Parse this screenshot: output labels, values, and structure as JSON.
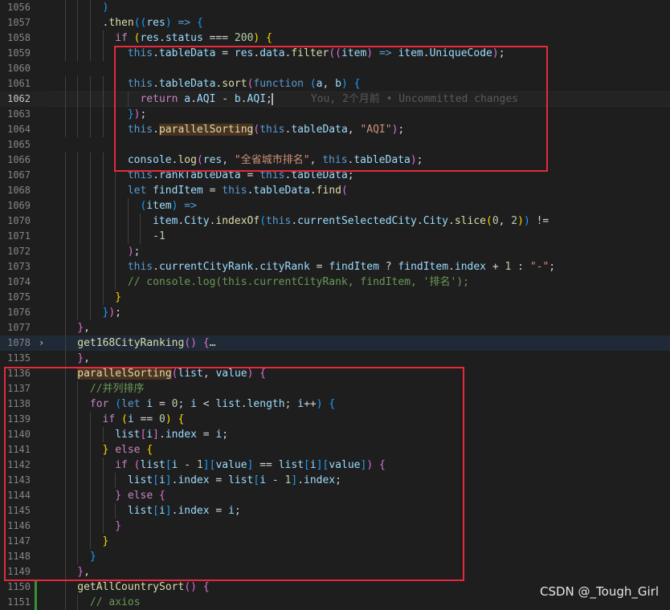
{
  "lines": [
    {
      "n": "1056",
      "ind": 8,
      "t": [
        [
          "p3",
          ")"
        ]
      ]
    },
    {
      "n": "1057",
      "ind": 8,
      "t": [
        [
          "pn",
          "."
        ],
        [
          "fn",
          "then"
        ],
        [
          "p3",
          "(("
        ],
        [
          "vr",
          "res"
        ],
        [
          "p3",
          ")"
        ],
        [
          "kw",
          " =>"
        ],
        [
          "pn",
          " "
        ],
        [
          "p3",
          "{"
        ]
      ]
    },
    {
      "n": "1058",
      "ind": 10,
      "t": [
        [
          "ctl",
          "if"
        ],
        [
          "pn",
          " "
        ],
        [
          "p1",
          "("
        ],
        [
          "vr",
          "res"
        ],
        [
          "pn",
          "."
        ],
        [
          "vr",
          "status"
        ],
        [
          "pn",
          " === "
        ],
        [
          "nm",
          "200"
        ],
        [
          "p1",
          ")"
        ],
        [
          "pn",
          " "
        ],
        [
          "p1",
          "{"
        ]
      ]
    },
    {
      "n": "1059",
      "ind": 12,
      "t": [
        [
          "kw",
          "this"
        ],
        [
          "pn",
          "."
        ],
        [
          "vr",
          "tableData"
        ],
        [
          "pn",
          " = "
        ],
        [
          "vr",
          "res"
        ],
        [
          "pn",
          "."
        ],
        [
          "vr",
          "data"
        ],
        [
          "pn",
          "."
        ],
        [
          "fn",
          "filter"
        ],
        [
          "p2",
          "(("
        ],
        [
          "vr",
          "item"
        ],
        [
          "p2",
          ")"
        ],
        [
          "kw",
          " =>"
        ],
        [
          "pn",
          " "
        ],
        [
          "vr",
          "item"
        ],
        [
          "pn",
          "."
        ],
        [
          "vr",
          "UniqueCode"
        ],
        [
          "p2",
          ")"
        ],
        [
          "pn",
          ";"
        ]
      ]
    },
    {
      "n": "1060",
      "ind": 0,
      "t": []
    },
    {
      "n": "1061",
      "ind": 12,
      "t": [
        [
          "kw",
          "this"
        ],
        [
          "pn",
          "."
        ],
        [
          "vr",
          "tableData"
        ],
        [
          "pn",
          "."
        ],
        [
          "fn",
          "sort"
        ],
        [
          "p2",
          "("
        ],
        [
          "kw",
          "function"
        ],
        [
          "pn",
          " "
        ],
        [
          "p3",
          "("
        ],
        [
          "vr",
          "a"
        ],
        [
          "pn",
          ", "
        ],
        [
          "vr",
          "b"
        ],
        [
          "p3",
          ")"
        ],
        [
          "pn",
          " "
        ],
        [
          "p3",
          "{"
        ]
      ]
    },
    {
      "n": "1062",
      "ind": 14,
      "cur": true,
      "t": [
        [
          "ctl",
          "return"
        ],
        [
          "pn",
          " "
        ],
        [
          "vr",
          "a"
        ],
        [
          "pn",
          "."
        ],
        [
          "vr",
          "AQI"
        ],
        [
          "pn",
          " - "
        ],
        [
          "vr",
          "b"
        ],
        [
          "pn",
          "."
        ],
        [
          "vr",
          "AQI"
        ],
        [
          "pn",
          ";"
        ]
      ]
    },
    {
      "n": "1063",
      "ind": 12,
      "t": [
        [
          "p3",
          "}"
        ],
        [
          "p2",
          ")"
        ],
        [
          "pn",
          ";"
        ]
      ]
    },
    {
      "n": "1064",
      "ind": 12,
      "t": [
        [
          "kw",
          "this"
        ],
        [
          "pn",
          "."
        ],
        [
          "fn",
          "parallelSorting",
          "hl"
        ],
        [
          "p2",
          "("
        ],
        [
          "kw",
          "this"
        ],
        [
          "pn",
          "."
        ],
        [
          "vr",
          "tableData"
        ],
        [
          "pn",
          ", "
        ],
        [
          "st",
          "\"AQI\""
        ],
        [
          "p2",
          ")"
        ],
        [
          "pn",
          ";"
        ]
      ]
    },
    {
      "n": "1065",
      "ind": 0,
      "t": []
    },
    {
      "n": "1066",
      "ind": 12,
      "t": [
        [
          "vr",
          "console"
        ],
        [
          "pn",
          "."
        ],
        [
          "fn",
          "log"
        ],
        [
          "p2",
          "("
        ],
        [
          "vr",
          "res"
        ],
        [
          "pn",
          ", "
        ],
        [
          "st",
          "\"全省城市排名\""
        ],
        [
          "pn",
          ", "
        ],
        [
          "kw",
          "this"
        ],
        [
          "pn",
          "."
        ],
        [
          "vr",
          "tableData"
        ],
        [
          "p2",
          ")"
        ],
        [
          "pn",
          ";"
        ]
      ]
    },
    {
      "n": "1067",
      "ind": 12,
      "t": [
        [
          "kw",
          "this"
        ],
        [
          "pn",
          "."
        ],
        [
          "vr",
          "rankTableData"
        ],
        [
          "pn",
          " = "
        ],
        [
          "kw",
          "this"
        ],
        [
          "pn",
          "."
        ],
        [
          "vr",
          "tableData"
        ],
        [
          "pn",
          ";"
        ]
      ]
    },
    {
      "n": "1068",
      "ind": 12,
      "t": [
        [
          "kw",
          "let"
        ],
        [
          "pn",
          " "
        ],
        [
          "vr",
          "findItem"
        ],
        [
          "pn",
          " = "
        ],
        [
          "kw",
          "this"
        ],
        [
          "pn",
          "."
        ],
        [
          "vr",
          "tableData"
        ],
        [
          "pn",
          "."
        ],
        [
          "fn",
          "find"
        ],
        [
          "p2",
          "("
        ]
      ]
    },
    {
      "n": "1069",
      "ind": 14,
      "t": [
        [
          "p3",
          "("
        ],
        [
          "vr",
          "item"
        ],
        [
          "p3",
          ")"
        ],
        [
          "kw",
          " =>"
        ]
      ]
    },
    {
      "n": "1070",
      "ind": 16,
      "t": [
        [
          "vr",
          "item"
        ],
        [
          "pn",
          "."
        ],
        [
          "vr",
          "City"
        ],
        [
          "pn",
          "."
        ],
        [
          "fn",
          "indexOf"
        ],
        [
          "p3",
          "("
        ],
        [
          "kw",
          "this"
        ],
        [
          "pn",
          "."
        ],
        [
          "vr",
          "currentSelectedCity"
        ],
        [
          "pn",
          "."
        ],
        [
          "vr",
          "City"
        ],
        [
          "pn",
          "."
        ],
        [
          "fn",
          "slice"
        ],
        [
          "p1",
          "("
        ],
        [
          "nm",
          "0"
        ],
        [
          "pn",
          ", "
        ],
        [
          "nm",
          "2"
        ],
        [
          "p1",
          ")"
        ],
        [
          "p3",
          ")"
        ],
        [
          "pn",
          " !="
        ]
      ]
    },
    {
      "n": "1071",
      "ind": 16,
      "t": [
        [
          "pn",
          "-"
        ],
        [
          "nm",
          "1"
        ]
      ]
    },
    {
      "n": "1072",
      "ind": 12,
      "t": [
        [
          "p2",
          ")"
        ],
        [
          "pn",
          ";"
        ]
      ]
    },
    {
      "n": "1073",
      "ind": 12,
      "t": [
        [
          "kw",
          "this"
        ],
        [
          "pn",
          "."
        ],
        [
          "vr",
          "currentCityRank"
        ],
        [
          "pn",
          "."
        ],
        [
          "vr",
          "cityRank"
        ],
        [
          "pn",
          " = "
        ],
        [
          "vr",
          "findItem"
        ],
        [
          "pn",
          " ? "
        ],
        [
          "vr",
          "findItem"
        ],
        [
          "pn",
          "."
        ],
        [
          "vr",
          "index"
        ],
        [
          "pn",
          " + "
        ],
        [
          "nm",
          "1"
        ],
        [
          "pn",
          " : "
        ],
        [
          "st",
          "\"-\""
        ],
        [
          "pn",
          ";"
        ]
      ]
    },
    {
      "n": "1074",
      "ind": 12,
      "t": [
        [
          "cm",
          "// console.log(this.currentCityRank, findItem, '排名');"
        ]
      ]
    },
    {
      "n": "1075",
      "ind": 10,
      "t": [
        [
          "p1",
          "}"
        ]
      ]
    },
    {
      "n": "1076",
      "ind": 8,
      "t": [
        [
          "p3",
          "}"
        ],
        [
          "p2",
          ")"
        ],
        [
          "pn",
          ";"
        ]
      ]
    },
    {
      "n": "1077",
      "ind": 4,
      "t": [
        [
          "p2",
          "}"
        ],
        [
          "pn",
          ","
        ]
      ]
    },
    {
      "n": "1078",
      "ind": 4,
      "fold": "›",
      "folded": true,
      "t": [
        [
          "fn",
          "get168CityRanking"
        ],
        [
          "p2",
          "()"
        ],
        [
          "pn",
          " "
        ],
        [
          "p2",
          "{"
        ],
        [
          "pn",
          "…"
        ]
      ]
    },
    {
      "n": "1135",
      "ind": 4,
      "t": [
        [
          "p2",
          "}"
        ],
        [
          "pn",
          ","
        ]
      ]
    },
    {
      "n": "1136",
      "ind": 4,
      "t": [
        [
          "fn",
          "parallelSorting",
          "hl"
        ],
        [
          "p2",
          "("
        ],
        [
          "vr",
          "list"
        ],
        [
          "pn",
          ", "
        ],
        [
          "vr",
          "value"
        ],
        [
          "p2",
          ")"
        ],
        [
          "pn",
          " "
        ],
        [
          "p2",
          "{"
        ]
      ]
    },
    {
      "n": "1137",
      "ind": 6,
      "t": [
        [
          "cm",
          "//并列排序"
        ]
      ]
    },
    {
      "n": "1138",
      "ind": 6,
      "t": [
        [
          "ctl",
          "for"
        ],
        [
          "pn",
          " "
        ],
        [
          "p3",
          "("
        ],
        [
          "kw",
          "let"
        ],
        [
          "pn",
          " "
        ],
        [
          "vr",
          "i"
        ],
        [
          "pn",
          " = "
        ],
        [
          "nm",
          "0"
        ],
        [
          "pn",
          "; "
        ],
        [
          "vr",
          "i"
        ],
        [
          "pn",
          " < "
        ],
        [
          "vr",
          "list"
        ],
        [
          "pn",
          "."
        ],
        [
          "vr",
          "length"
        ],
        [
          "pn",
          "; "
        ],
        [
          "vr",
          "i"
        ],
        [
          "pn",
          "++"
        ],
        [
          "p3",
          ")"
        ],
        [
          "pn",
          " "
        ],
        [
          "p3",
          "{"
        ]
      ]
    },
    {
      "n": "1139",
      "ind": 8,
      "t": [
        [
          "ctl",
          "if"
        ],
        [
          "pn",
          " "
        ],
        [
          "p1",
          "("
        ],
        [
          "vr",
          "i"
        ],
        [
          "pn",
          " == "
        ],
        [
          "nm",
          "0"
        ],
        [
          "p1",
          ")"
        ],
        [
          "pn",
          " "
        ],
        [
          "p1",
          "{"
        ]
      ]
    },
    {
      "n": "1140",
      "ind": 10,
      "t": [
        [
          "vr",
          "list"
        ],
        [
          "p2",
          "["
        ],
        [
          "vr",
          "i"
        ],
        [
          "p2",
          "]"
        ],
        [
          "pn",
          "."
        ],
        [
          "vr",
          "index"
        ],
        [
          "pn",
          " = "
        ],
        [
          "vr",
          "i"
        ],
        [
          "pn",
          ";"
        ]
      ]
    },
    {
      "n": "1141",
      "ind": 8,
      "t": [
        [
          "p1",
          "}"
        ],
        [
          "pn",
          " "
        ],
        [
          "ctl",
          "else"
        ],
        [
          "pn",
          " "
        ],
        [
          "p1",
          "{"
        ]
      ]
    },
    {
      "n": "1142",
      "ind": 10,
      "t": [
        [
          "ctl",
          "if"
        ],
        [
          "pn",
          " "
        ],
        [
          "p2",
          "("
        ],
        [
          "vr",
          "list"
        ],
        [
          "p3",
          "["
        ],
        [
          "vr",
          "i"
        ],
        [
          "pn",
          " - "
        ],
        [
          "nm",
          "1"
        ],
        [
          "p3",
          "]["
        ],
        [
          "vr",
          "value"
        ],
        [
          "p3",
          "]"
        ],
        [
          "pn",
          " == "
        ],
        [
          "vr",
          "list"
        ],
        [
          "p3",
          "["
        ],
        [
          "vr",
          "i"
        ],
        [
          "p3",
          "]["
        ],
        [
          "vr",
          "value"
        ],
        [
          "p3",
          "]"
        ],
        [
          "p2",
          ")"
        ],
        [
          "pn",
          " "
        ],
        [
          "p2",
          "{"
        ]
      ]
    },
    {
      "n": "1143",
      "ind": 12,
      "t": [
        [
          "vr",
          "list"
        ],
        [
          "p3",
          "["
        ],
        [
          "vr",
          "i"
        ],
        [
          "p3",
          "]"
        ],
        [
          "pn",
          "."
        ],
        [
          "vr",
          "index"
        ],
        [
          "pn",
          " = "
        ],
        [
          "vr",
          "list"
        ],
        [
          "p3",
          "["
        ],
        [
          "vr",
          "i"
        ],
        [
          "pn",
          " - "
        ],
        [
          "nm",
          "1"
        ],
        [
          "p3",
          "]"
        ],
        [
          "pn",
          "."
        ],
        [
          "vr",
          "index"
        ],
        [
          "pn",
          ";"
        ]
      ]
    },
    {
      "n": "1144",
      "ind": 10,
      "t": [
        [
          "p2",
          "}"
        ],
        [
          "pn",
          " "
        ],
        [
          "ctl",
          "else"
        ],
        [
          "pn",
          " "
        ],
        [
          "p2",
          "{"
        ]
      ]
    },
    {
      "n": "1145",
      "ind": 12,
      "t": [
        [
          "vr",
          "list"
        ],
        [
          "p3",
          "["
        ],
        [
          "vr",
          "i"
        ],
        [
          "p3",
          "]"
        ],
        [
          "pn",
          "."
        ],
        [
          "vr",
          "index"
        ],
        [
          "pn",
          " = "
        ],
        [
          "vr",
          "i"
        ],
        [
          "pn",
          ";"
        ]
      ]
    },
    {
      "n": "1146",
      "ind": 10,
      "t": [
        [
          "p2",
          "}"
        ]
      ]
    },
    {
      "n": "1147",
      "ind": 8,
      "t": [
        [
          "p1",
          "}"
        ]
      ]
    },
    {
      "n": "1148",
      "ind": 6,
      "t": [
        [
          "p3",
          "}"
        ]
      ]
    },
    {
      "n": "1149",
      "ind": 4,
      "t": [
        [
          "p2",
          "}"
        ],
        [
          "pn",
          ","
        ]
      ]
    },
    {
      "n": "1150",
      "ind": 4,
      "git": true,
      "t": [
        [
          "fn",
          "getAllCountrySort"
        ],
        [
          "p2",
          "()"
        ],
        [
          "pn",
          " "
        ],
        [
          "p2",
          "{"
        ]
      ]
    },
    {
      "n": "1151",
      "ind": 6,
      "git": true,
      "t": [
        [
          "cm",
          "// axios"
        ]
      ]
    }
  ],
  "blame": "You, 2个月前 • Uncommitted changes",
  "watermark": "CSDN @_Tough_Girl",
  "colors": {
    "background": "#1e1e1e",
    "highlight_box": "#e8283b",
    "git_added": "#3b8f3b"
  }
}
